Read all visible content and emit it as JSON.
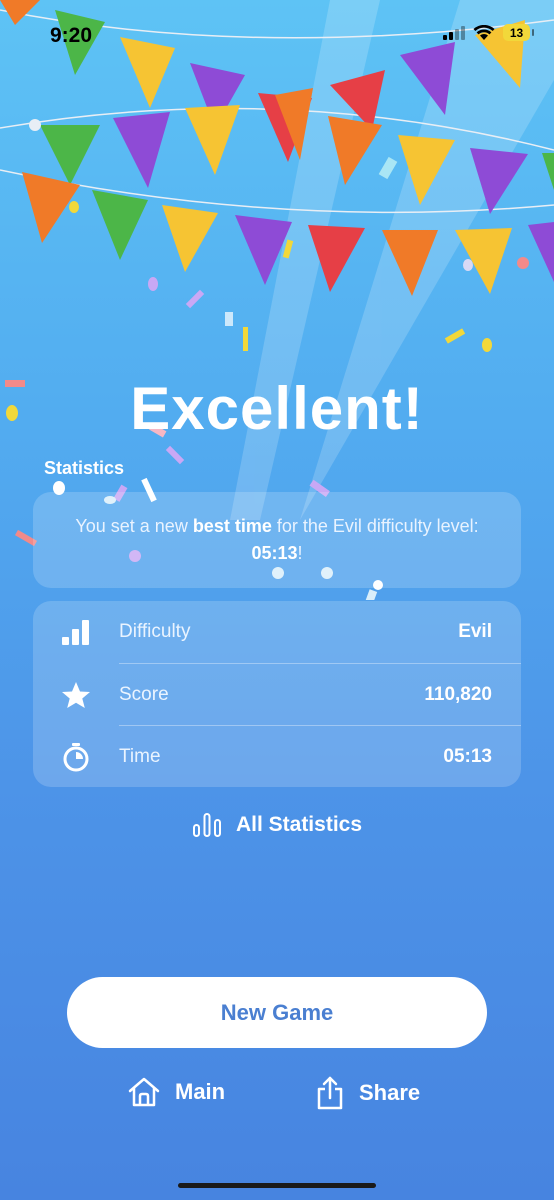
{
  "status_bar": {
    "time": "9:20",
    "battery": "13"
  },
  "title": "Excellent!",
  "section_label": "Statistics",
  "record": {
    "prefix": "You set a new ",
    "highlight": "best time",
    "middle": " for the Evil difficulty level: ",
    "time": "05:13",
    "suffix": "!"
  },
  "stats": [
    {
      "icon": "bar-chart-icon",
      "label": "Difficulty",
      "value": "Evil"
    },
    {
      "icon": "star-icon",
      "label": "Score",
      "value": "110,820"
    },
    {
      "icon": "stopwatch-icon",
      "label": "Time",
      "value": "05:13"
    }
  ],
  "all_statistics_label": "All Statistics",
  "new_game_label": "New Game",
  "bottom_nav": {
    "main_label": "Main",
    "share_label": "Share"
  },
  "colors": {
    "accent": "#4a7fd1",
    "background_top": "#5ec3f5",
    "background_bottom": "#4784e0"
  }
}
